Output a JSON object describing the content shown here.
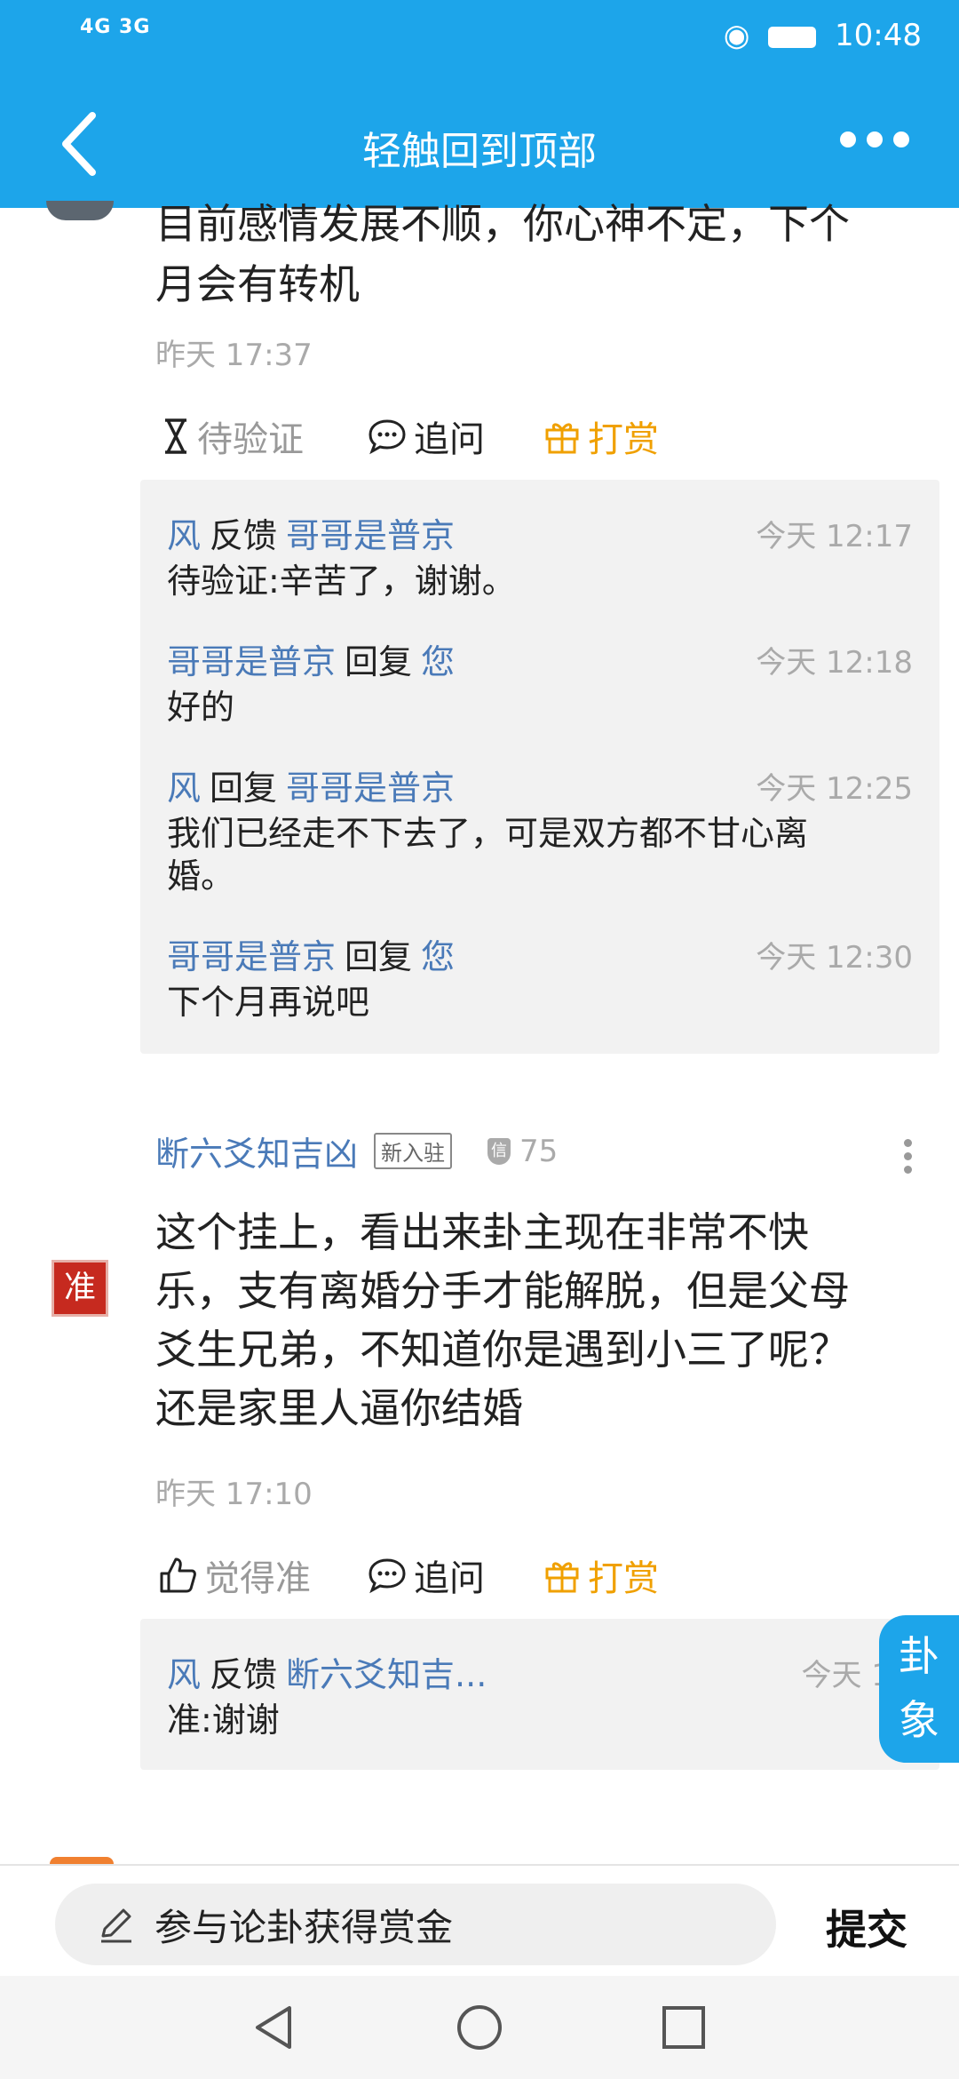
{
  "status_bar": {
    "left": "4G 3G",
    "time": "10:48"
  },
  "header": {
    "title": "轻触回到顶部"
  },
  "answer1": {
    "text_line1": "目前感情发展不顺，你心神不定，下个",
    "text_line2": "月会有转机",
    "time": "昨天 17:37",
    "actions": {
      "verify": "待验证",
      "ask": "追问",
      "reward": "打赏"
    },
    "replies": [
      {
        "from": "风",
        "verb": "反馈",
        "to": "哥哥是普京",
        "time": "今天 12:17",
        "body": "待验证:辛苦了，谢谢。"
      },
      {
        "from": "哥哥是普京",
        "verb": "回复",
        "to": "您",
        "time": "今天 12:18",
        "body": "好的"
      },
      {
        "from": "风",
        "verb": "回复",
        "to": "哥哥是普京",
        "time": "今天 12:25",
        "body": "我们已经走不下去了，可是双方都不甘心离婚。"
      },
      {
        "from": "哥哥是普京",
        "verb": "回复",
        "to": "您",
        "time": "今天 12:30",
        "body": "下个月再说吧"
      }
    ]
  },
  "answer2": {
    "author": "断六爻知吉凶",
    "badge": "新入驻",
    "cred_icon": "信",
    "cred_value": "75",
    "avatar_text": "准",
    "text_line1": "这个挂上，看出来卦主现在非常不快",
    "text_line2": "乐，支有离婚分手才能解脱，但是父母",
    "text_line3": "爻生兄弟，不知道你是遇到小三了呢？",
    "text_line4": "还是家里人逼你结婚",
    "time": "昨天 17:10",
    "actions": {
      "accurate": "觉得准",
      "ask": "追问",
      "reward": "打赏"
    },
    "reply": {
      "from": "风",
      "verb": "反馈",
      "to": "断六爻知吉...",
      "time": "今天 12:",
      "body": "准:谢谢"
    }
  },
  "float_tab": {
    "line1": "卦",
    "line2": "象"
  },
  "bottom": {
    "placeholder": "参与论卦获得赏金",
    "submit": "提交"
  },
  "colors": {
    "primary": "#1da5ea",
    "link": "#4a7ab8",
    "reward": "#f0a000"
  }
}
